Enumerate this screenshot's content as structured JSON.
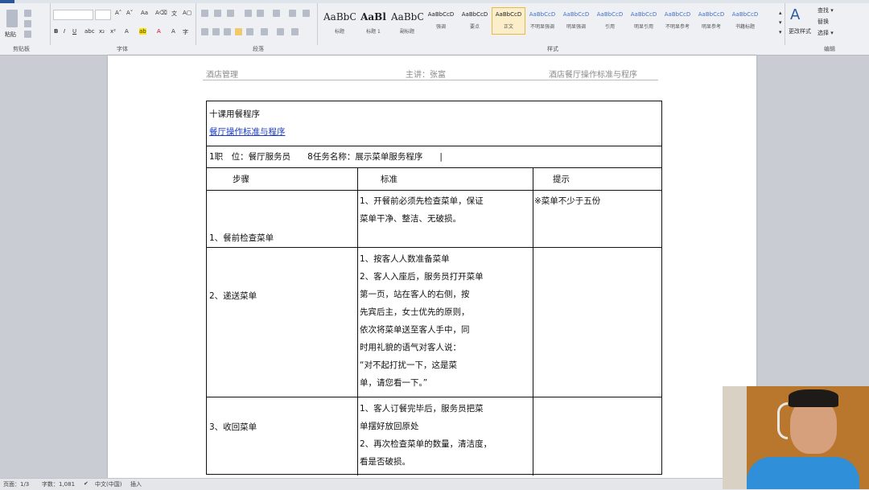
{
  "ribbon": {
    "groups": {
      "clipboard": "剪贴板",
      "font": "字体",
      "paragraph": "段落",
      "styles": "样式",
      "editing": "编辑"
    },
    "clipboard_paste": "粘贴",
    "editing_items": [
      "查找 ▾",
      "替换",
      "选择 ▾"
    ],
    "styles": [
      {
        "preview": "AaBbC",
        "name": "标题"
      },
      {
        "preview": "AaBl",
        "name": "标题 1"
      },
      {
        "preview": "AaBbC",
        "name": "副标题"
      },
      {
        "preview": "AaBbCcD",
        "name": "强调"
      },
      {
        "preview": "AaBbCcD",
        "name": "要点"
      },
      {
        "preview": "AaBbCcD",
        "name": "正文"
      },
      {
        "preview": "AaBbCcD",
        "name": "不明显强调"
      },
      {
        "preview": "AaBbCcD",
        "name": "明显强调"
      },
      {
        "preview": "AaBbCcD",
        "name": "引用"
      },
      {
        "preview": "AaBbCcD",
        "name": "明显引用"
      },
      {
        "preview": "AaBbCcD",
        "name": "不明显参考"
      },
      {
        "preview": "AaBbCcD",
        "name": "明显参考"
      },
      {
        "preview": "AaBbCcD",
        "name": "书籍标题"
      }
    ],
    "change_styles": "更改样式"
  },
  "document": {
    "header": {
      "left": "酒店管理",
      "center": "主讲：张富",
      "right": "酒店餐厅操作标准与程序"
    },
    "table": {
      "title_line1": "十课用餐程序",
      "title_line2": "餐厅操作标准与程序",
      "info_line": "1职　位：餐厅服务员　　8任务名称：展示菜单服务程序　　|",
      "col_headers": [
        "步骤",
        "标准",
        "提示"
      ],
      "rows": [
        {
          "step": "1、餐前检查菜单",
          "standard": [
            "1、开餐前必须先检查菜单，保证",
            "菜单干净、整洁、无破损。"
          ],
          "tip": "※菜单不少于五份"
        },
        {
          "step": "2、递送菜单",
          "standard": [
            "1、按客人人数准备菜单",
            "2、客人入座后，服务员打开菜单",
            "第一页，站在客人的右侧，按",
            "先宾后主，女士优先的原则，",
            "依次将菜单送至客人手中，同",
            "时用礼貌的语气对客人说：",
            "“对不起打扰一下，这是菜",
            "单，请您看一下。”"
          ],
          "tip": ""
        },
        {
          "step": "3、收回菜单",
          "standard": [
            "1、客人订餐完毕后，服务员把菜",
            "单摆好放回原处",
            "2、再次检查菜单的数量，清洁度，",
            "看是否破损。"
          ],
          "tip": ""
        }
      ]
    }
  },
  "status_bar": {
    "page": "页面：1/3",
    "words": "字数：1,081",
    "language": "中文(中国)",
    "mode": "插入"
  }
}
